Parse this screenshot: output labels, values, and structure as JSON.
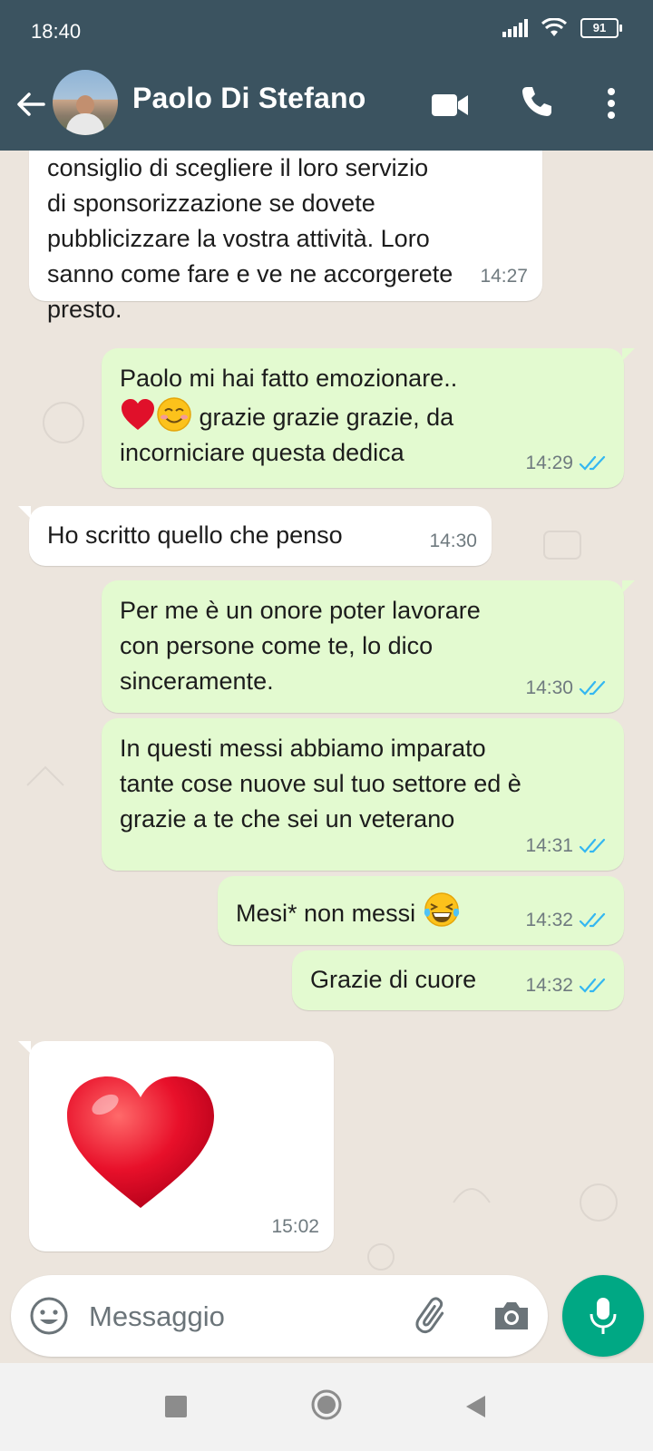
{
  "status": {
    "time": "18:40",
    "battery": "91"
  },
  "header": {
    "contact_name": "Paolo Di Stefano"
  },
  "messages": [
    {
      "dir": "in",
      "text": "consiglio di scegliere il loro servizio\ndi sponsorizzazione se dovete\npubblicizzare la vostra attività. Loro\nsanno come fare e ve ne accorgerete\npresto.",
      "time": "14:27"
    },
    {
      "dir": "out",
      "line1": "Paolo mi hai fatto emozionare..",
      "line2": " grazie grazie grazie, da",
      "line3": "incorniciare questa dedica",
      "time": "14:29"
    },
    {
      "dir": "in",
      "text": "Ho scritto quello che penso",
      "time": "14:30"
    },
    {
      "dir": "out",
      "text": "Per me è un onore poter lavorare\ncon persone come te, lo dico\nsinceramente.",
      "time": "14:30"
    },
    {
      "dir": "out",
      "text": "In questi messi abbiamo imparato\ntante cose nuove sul tuo settore ed è\ngrazie a te che sei un veterano",
      "time": "14:31"
    },
    {
      "dir": "out",
      "text": "Mesi* non messi ",
      "time": "14:32"
    },
    {
      "dir": "out",
      "text": "Grazie di cuore",
      "time": "14:32"
    },
    {
      "dir": "in",
      "emoji": "red-heart",
      "time": "15:02"
    }
  ],
  "composer": {
    "placeholder": "Messaggio"
  },
  "colors": {
    "header_bg": "#3b5360",
    "chat_bg": "#ece5dd",
    "outgoing_bubble": "#e3fad0",
    "incoming_bubble": "#ffffff",
    "read_ticks": "#34b7f1",
    "mic_button": "#00a884"
  },
  "icons": [
    "back-arrow-icon",
    "video-call-icon",
    "phone-icon",
    "more-vert-icon",
    "emoji-icon",
    "attach-icon",
    "camera-icon",
    "mic-icon",
    "double-check-icon"
  ]
}
